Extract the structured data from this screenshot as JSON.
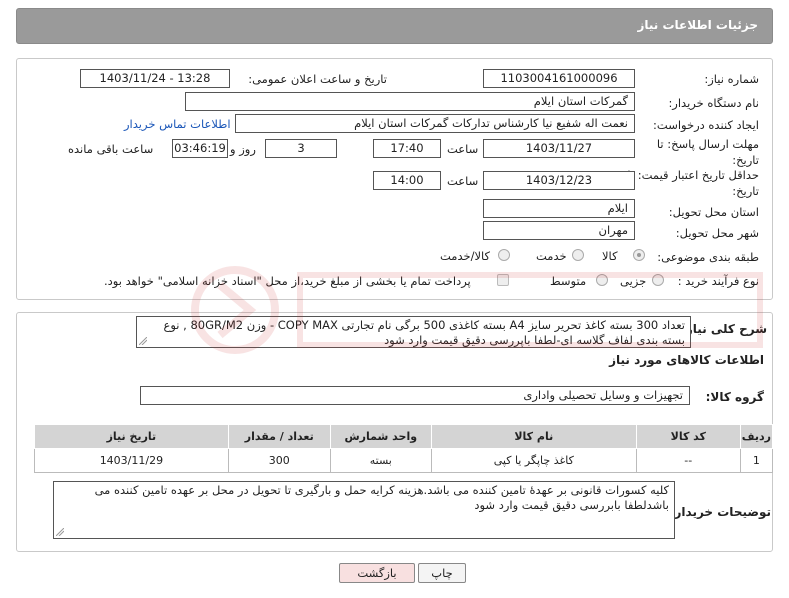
{
  "header": {
    "title": "جزئیات اطلاعات نیاز"
  },
  "form": {
    "need_number_label": "شماره نیاز:",
    "need_number": "1103004161000096",
    "announce_label": "تاریخ و ساعت اعلان عمومی:",
    "announce_value": "1403/11/24 - 13:28",
    "buyer_org_label": "نام دستگاه خریدار:",
    "buyer_org": "گمرکات استان ایلام",
    "creator_label": "ایجاد کننده درخواست:",
    "creator": "نعمت اله شفیع نیا کارشناس تدارکات گمرکات استان ایلام",
    "contact_link": "اطلاعات تماس خریدار",
    "deadline_label": "مهلت ارسال پاسخ: تا تاریخ:",
    "deadline_date": "1403/11/27",
    "time_label": "ساعت",
    "deadline_time": "17:40",
    "days_value": "3",
    "days_and_label": "روز و",
    "remaining_time": "03:46:19",
    "remaining_label": "ساعت باقی مانده",
    "validity_label": "حداقل تاریخ اعتبار قیمت: تا تاریخ:",
    "validity_date": "1403/12/23",
    "validity_time_label": "ساعت",
    "validity_time": "14:00",
    "province_label": "استان محل تحویل:",
    "province": "ایلام",
    "city_label": "شهر محل تحویل:",
    "city": "مهران",
    "category_label": "طبقه بندی موضوعی:",
    "category_options": [
      "کالا",
      "خدمت",
      "کالا/خدمت"
    ],
    "purchase_label": "نوع فرآیند خرید :",
    "purchase_options": [
      "جزیی",
      "متوسط"
    ],
    "payment_text": "پرداخت تمام یا بخشی از مبلغ خرید،از محل \"اسناد خزانه اسلامی\" خواهد بود."
  },
  "details": {
    "summary_label": "شرح کلی نیاز:",
    "summary_text": "تعداد 300 بسته کاغذ تحریر سایز A4 بسته کاغذی 500 برگی نام تجارتی COPY MAX - وزن 80GR/M2 , نوع بسته بندی لفاف گلاسه ای-لطفا باپررسی دقیق قیمت وارد شود",
    "goods_info_title": "اطلاعات کالاهای مورد نیاز",
    "goods_group_label": "گروه کالا:",
    "goods_group": "تجهیزات و وسایل تحصیلی واداری",
    "table_headers": [
      "ردیف",
      "کد کالا",
      "نام کالا",
      "واحد شمارش",
      "تعداد / مقدار",
      "تاریخ نیاز"
    ],
    "rows": [
      [
        "1",
        "--",
        "کاغذ چاپگر یا کپی",
        "بسته",
        "300",
        "1403/11/29"
      ]
    ],
    "buyer_notes_label": "توضیحات خریدار:",
    "buyer_notes": "کلیه کسورات قانونی بر عهدهٔ تامین کننده می باشد.هزینه  کرایه حمل و بارگیری تا تحویل در محل بر عهده تامین کننده می باشدلطفا بابررسی دقیق قیمت وارد شود"
  },
  "footer": {
    "print_label": "چاپ",
    "back_label": "بازگشت"
  },
  "colors": {
    "header_bg": "#9a9a9a",
    "link": "#1a56b8",
    "back_button_bg": "#f8e0e0"
  }
}
